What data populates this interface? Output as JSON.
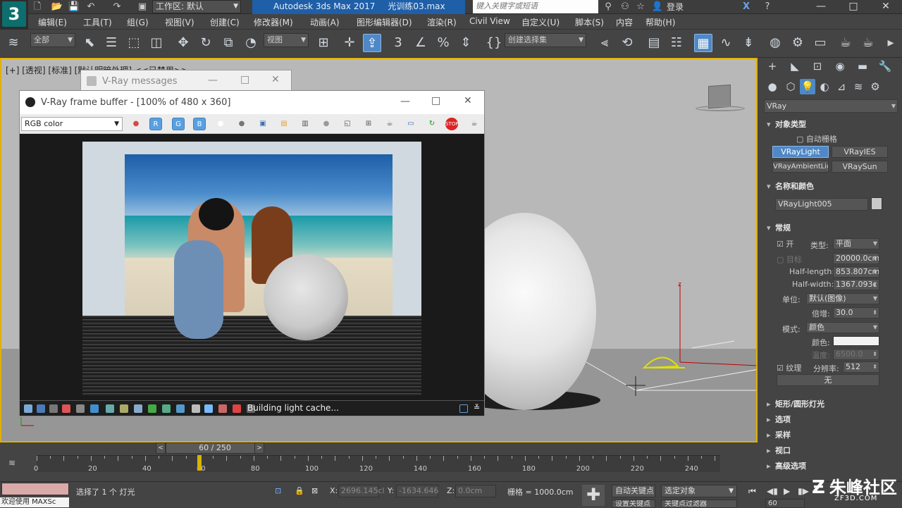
{
  "titlebar": {
    "app_logo": "3",
    "workspace": "工作区: 默认",
    "app_name": "Autodesk 3ds Max 2017",
    "file_name": "光训练03.max",
    "search_placeholder": "键入关键字或短语",
    "login": "登录"
  },
  "menu": [
    "编辑(E)",
    "工具(T)",
    "组(G)",
    "视图(V)",
    "创建(C)",
    "修改器(M)",
    "动画(A)",
    "图形编辑器(D)",
    "渲染(R)",
    "Civil View",
    "自定义(U)",
    "脚本(S)",
    "内容",
    "帮助(H)"
  ],
  "toolbar": {
    "selection_filter": "全部",
    "ref_coord": "视图",
    "selection_set": "创建选择集"
  },
  "viewport": {
    "label": "[+] [透视] [标准] [默认明暗处理] <<已禁用>>"
  },
  "vfb_messages": {
    "title": "V-Ray messages"
  },
  "vfb": {
    "title": "V-Ray frame buffer - [100% of 480 x 360]",
    "channel": "RGB color",
    "status": "Building light cache..."
  },
  "cmdpanel": {
    "category": "VRay",
    "object_type_title": "对象类型",
    "autogrid": "自动栅格",
    "buttons": [
      "VRayLight",
      "VRayIES",
      "VRayAmbientLigh",
      "VRaySun"
    ],
    "name_color_title": "名称和颜色",
    "object_name": "VRayLight005",
    "general_title": "常规",
    "on_label": "开",
    "type_label": "类型:",
    "type_value": "平面",
    "target_label": "目标",
    "target_value": "20000.0cm",
    "half_length_label": "Half-length:",
    "half_length_value": "853.807cm",
    "half_width_label": "Half-width:",
    "half_width_value": "1367.093c",
    "units_label": "单位:",
    "units_value": "默认(图像)",
    "multiplier_label": "倍增:",
    "multiplier_value": "30.0",
    "mode_label": "模式:",
    "mode_value": "颜色",
    "color_label": "颜色:",
    "temperature_label": "温度:",
    "temperature_value": "6500.0",
    "texture_label": "纹理",
    "resolution_label": "分辨率:",
    "resolution_value": "512",
    "none_button": "无",
    "rollouts": [
      "矩形/圆形灯光",
      "选项",
      "采样",
      "视口",
      "高级选项"
    ]
  },
  "timeline": {
    "frame_display": "60 / 250",
    "current_frame": 60,
    "total_frames": 250,
    "ticks": [
      "0",
      "20",
      "40",
      "60",
      "80",
      "100",
      "120",
      "140",
      "160",
      "180",
      "200",
      "220",
      "240"
    ]
  },
  "statusbar": {
    "maxscript": "欢迎使用 MAXSc",
    "selection_msg": "选择了 1 个 灯光",
    "x_label": "X:",
    "x_value": "2696.145cl",
    "y_label": "Y:",
    "y_value": "-1634.646",
    "z_label": "Z:",
    "z_value": "0.0cm",
    "grid_label": "栅格 = 1000.0cm",
    "auto_key": "自动关键点",
    "selected_obj": "选定对象",
    "set_key": "设置关键点",
    "key_filters": "关键点过滤器",
    "frame_field": "60"
  },
  "watermark": {
    "text": "朱峰社区",
    "sub": "ZF3D.COM"
  },
  "colors": {
    "accent": "#4f88c6",
    "title_blue": "#1e5fa8",
    "viewport_border": "#e0b000"
  }
}
